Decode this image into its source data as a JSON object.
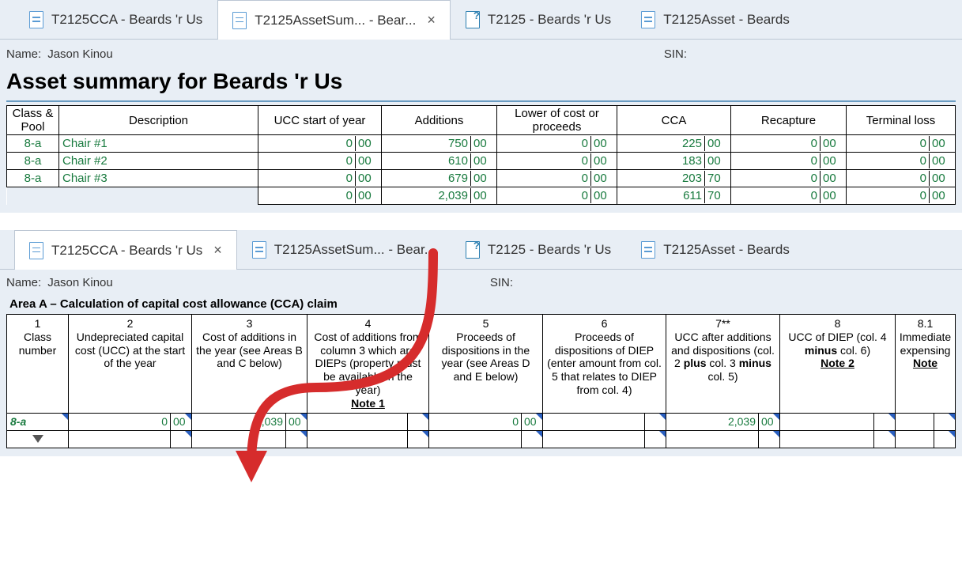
{
  "tabs_top": [
    {
      "label": "T2125CCA - Beards 'r Us",
      "active": false,
      "close": false,
      "icon": "doc"
    },
    {
      "label": "T2125AssetSum... - Bear...",
      "active": true,
      "close": true,
      "icon": "doc"
    },
    {
      "label": "T2125 - Beards 'r Us",
      "active": false,
      "close": false,
      "icon": "help"
    },
    {
      "label": "T2125Asset - Beards",
      "active": false,
      "close": false,
      "icon": "doc"
    }
  ],
  "tabs_bottom": [
    {
      "label": "T2125CCA - Beards 'r Us",
      "active": true,
      "close": true,
      "icon": "doc"
    },
    {
      "label": "T2125AssetSum... - Bear...",
      "active": false,
      "close": false,
      "icon": "doc"
    },
    {
      "label": "T2125 - Beards 'r Us",
      "active": false,
      "close": false,
      "icon": "help"
    },
    {
      "label": "T2125Asset - Beards",
      "active": false,
      "close": false,
      "icon": "doc"
    }
  ],
  "name_label": "Name:",
  "name_value": "Jason Kinou",
  "sin_label": "SIN:",
  "title": "Asset summary for Beards 'r Us",
  "asset_headers": [
    "Class & Pool",
    "Description",
    "UCC start of year",
    "Additions",
    "Lower of cost or proceeds",
    "CCA",
    "Recapture",
    "Terminal loss"
  ],
  "asset_rows": [
    {
      "cls": "8-a",
      "desc": "Chair #1",
      "ucc": {
        "w": "0",
        "c": "00"
      },
      "add": {
        "w": "750",
        "c": "00"
      },
      "low": {
        "w": "0",
        "c": "00"
      },
      "cca": {
        "w": "225",
        "c": "00"
      },
      "rec": {
        "w": "0",
        "c": "00"
      },
      "tl": {
        "w": "0",
        "c": "00"
      }
    },
    {
      "cls": "8-a",
      "desc": "Chair #2",
      "ucc": {
        "w": "0",
        "c": "00"
      },
      "add": {
        "w": "610",
        "c": "00"
      },
      "low": {
        "w": "0",
        "c": "00"
      },
      "cca": {
        "w": "183",
        "c": "00"
      },
      "rec": {
        "w": "0",
        "c": "00"
      },
      "tl": {
        "w": "0",
        "c": "00"
      }
    },
    {
      "cls": "8-a",
      "desc": "Chair #3",
      "ucc": {
        "w": "0",
        "c": "00"
      },
      "add": {
        "w": "679",
        "c": "00"
      },
      "low": {
        "w": "0",
        "c": "00"
      },
      "cca": {
        "w": "203",
        "c": "70"
      },
      "rec": {
        "w": "0",
        "c": "00"
      },
      "tl": {
        "w": "0",
        "c": "00"
      }
    }
  ],
  "asset_totals": {
    "ucc": {
      "w": "0",
      "c": "00"
    },
    "add": {
      "w": "2,039",
      "c": "00"
    },
    "low": {
      "w": "0",
      "c": "00"
    },
    "cca": {
      "w": "611",
      "c": "70"
    },
    "rec": {
      "w": "0",
      "c": "00"
    },
    "tl": {
      "w": "0",
      "c": "00"
    }
  },
  "area_a_title": "Area A – Calculation of capital cost allowance (CCA) claim",
  "cca_headers": {
    "c1": {
      "n": "1",
      "t": "Class number"
    },
    "c2": {
      "n": "2",
      "t": "Undepreciated capital cost (UCC) at the start of the year"
    },
    "c3": {
      "n": "3",
      "t": "Cost of additions in the year (see Areas B and C below)"
    },
    "c4": {
      "n": "4",
      "t": "Cost of additions from column 3 which are DIEPs (property must be available in the year)",
      "note": "Note 1"
    },
    "c5": {
      "n": "5",
      "t": "Proceeds of dispositions in the year (see Areas D and E below)"
    },
    "c6": {
      "n": "6",
      "t": "Proceeds of dispositions of DIEP (enter amount from col. 5 that relates to DIEP from col. 4)"
    },
    "c7": {
      "n": "7**",
      "t_a": "UCC after additions and dispositions (col. 2 ",
      "t_b": "plus",
      "t_c": " col. 3 ",
      "t_d": "minus",
      "t_e": " col. 5)"
    },
    "c8": {
      "n": "8",
      "t_a": "UCC of DIEP (col. 4 ",
      "t_b": "minus",
      "t_c": " col. 6)",
      "note": "Note 2"
    },
    "c81": {
      "n": "8.1",
      "t": "Immediate expensing",
      "note": "Note "
    }
  },
  "cca_row": {
    "cls": "8-a",
    "c2": {
      "w": "0",
      "c": "00"
    },
    "c3": {
      "w": "2,039",
      "c": "00"
    },
    "c4": {
      "w": "",
      "c": ""
    },
    "c5": {
      "w": "0",
      "c": "00"
    },
    "c6": {
      "w": "",
      "c": ""
    },
    "c7": {
      "w": "2,039",
      "c": "00"
    },
    "c8": {
      "w": "",
      "c": ""
    },
    "c81": {
      "w": "",
      "c": ""
    }
  }
}
